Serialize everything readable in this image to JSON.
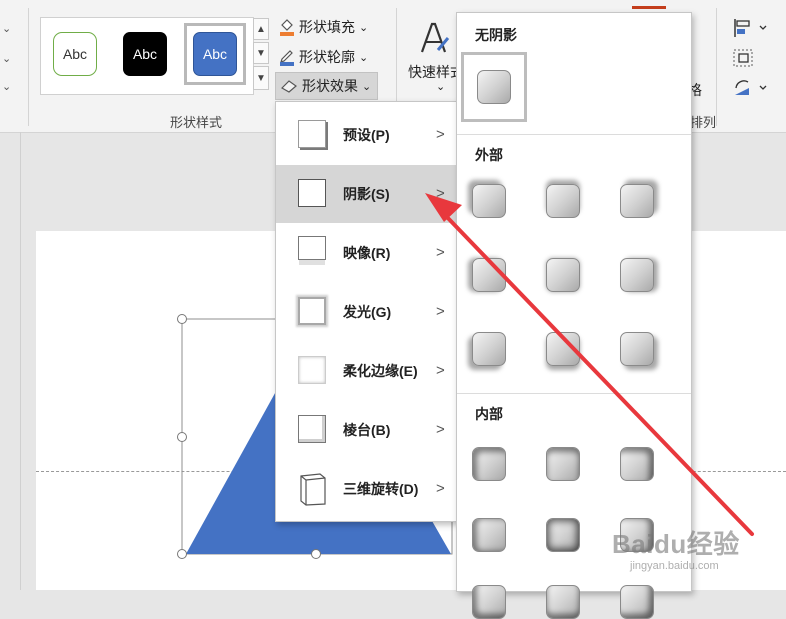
{
  "ribbon": {
    "gallery": {
      "styles": [
        "Abc",
        "Abc",
        "Abc"
      ]
    },
    "shape_fill": "形状填充",
    "shape_outline": "形状轮廓",
    "shape_effects": "形状效果",
    "group_label": "形状样式",
    "quick_styles": "快速样式",
    "arrange_label": "排列",
    "arrange_fragment_1": "格",
    "dropdown_caret": "⌄"
  },
  "effects_menu": {
    "items": [
      {
        "label": "预设(P)",
        "arrow": ">"
      },
      {
        "label": "阴影(S)",
        "arrow": ">"
      },
      {
        "label": "映像(R)",
        "arrow": ">"
      },
      {
        "label": "发光(G)",
        "arrow": ">"
      },
      {
        "label": "柔化边缘(E)",
        "arrow": ">"
      },
      {
        "label": "棱台(B)",
        "arrow": ">"
      },
      {
        "label": "三维旋转(D)",
        "arrow": ">"
      }
    ]
  },
  "shadow_panel": {
    "no_shadow": "无阴影",
    "outer": "外部",
    "inner": "内部"
  },
  "watermark": {
    "brand": "Baidu经验",
    "url": "jingyan.baidu.com"
  },
  "colors": {
    "shape_fill": "#4472c4",
    "arrow": "#e8383d",
    "fill_accent": "#ed7d31",
    "outline_accent": "#4472c4"
  }
}
